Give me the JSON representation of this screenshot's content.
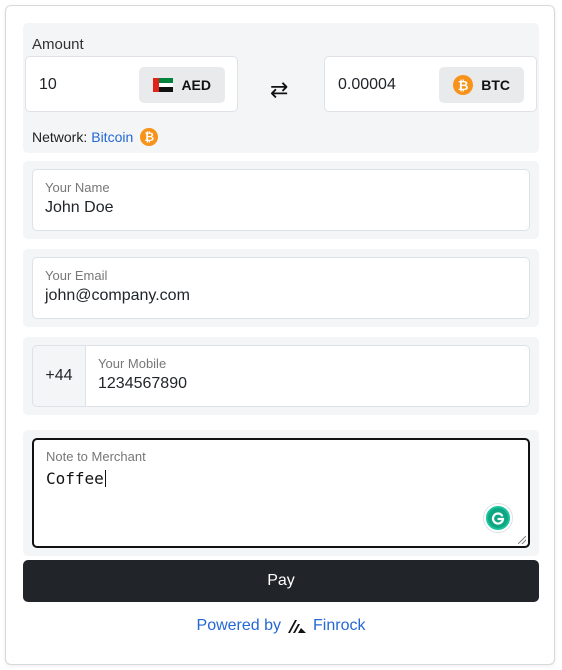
{
  "amount": {
    "label": "Amount",
    "from_value": "10",
    "from_currency": "AED",
    "to_value": "0.00004",
    "to_currency": "BTC",
    "swap_symbol": "⇄"
  },
  "network": {
    "label": "Network:",
    "value": "Bitcoin",
    "coin_symbol": "₿"
  },
  "name": {
    "label": "Your Name",
    "value": "John Doe"
  },
  "email": {
    "label": "Your Email",
    "value": "john@company.com"
  },
  "mobile": {
    "prefix": "+44",
    "label": "Your Mobile",
    "value": "1234567890"
  },
  "note": {
    "label": "Note to Merchant",
    "value": "Coffee"
  },
  "pay_button": {
    "label": "Pay"
  },
  "footer": {
    "powered_by": "Powered by",
    "brand": "Finrock"
  },
  "icons": {
    "flag": "uae-flag-icon",
    "coin": "bitcoin-icon",
    "swap": "swap-arrows-icon",
    "grammarly": "grammarly-icon",
    "logo": "finrock-logo-icon"
  },
  "colors": {
    "bitcoin": "#f7931a",
    "link": "#2468d4",
    "pay_button": "#212529",
    "panel_bg": "#f4f5f7",
    "grammarly": "#15c39a"
  }
}
